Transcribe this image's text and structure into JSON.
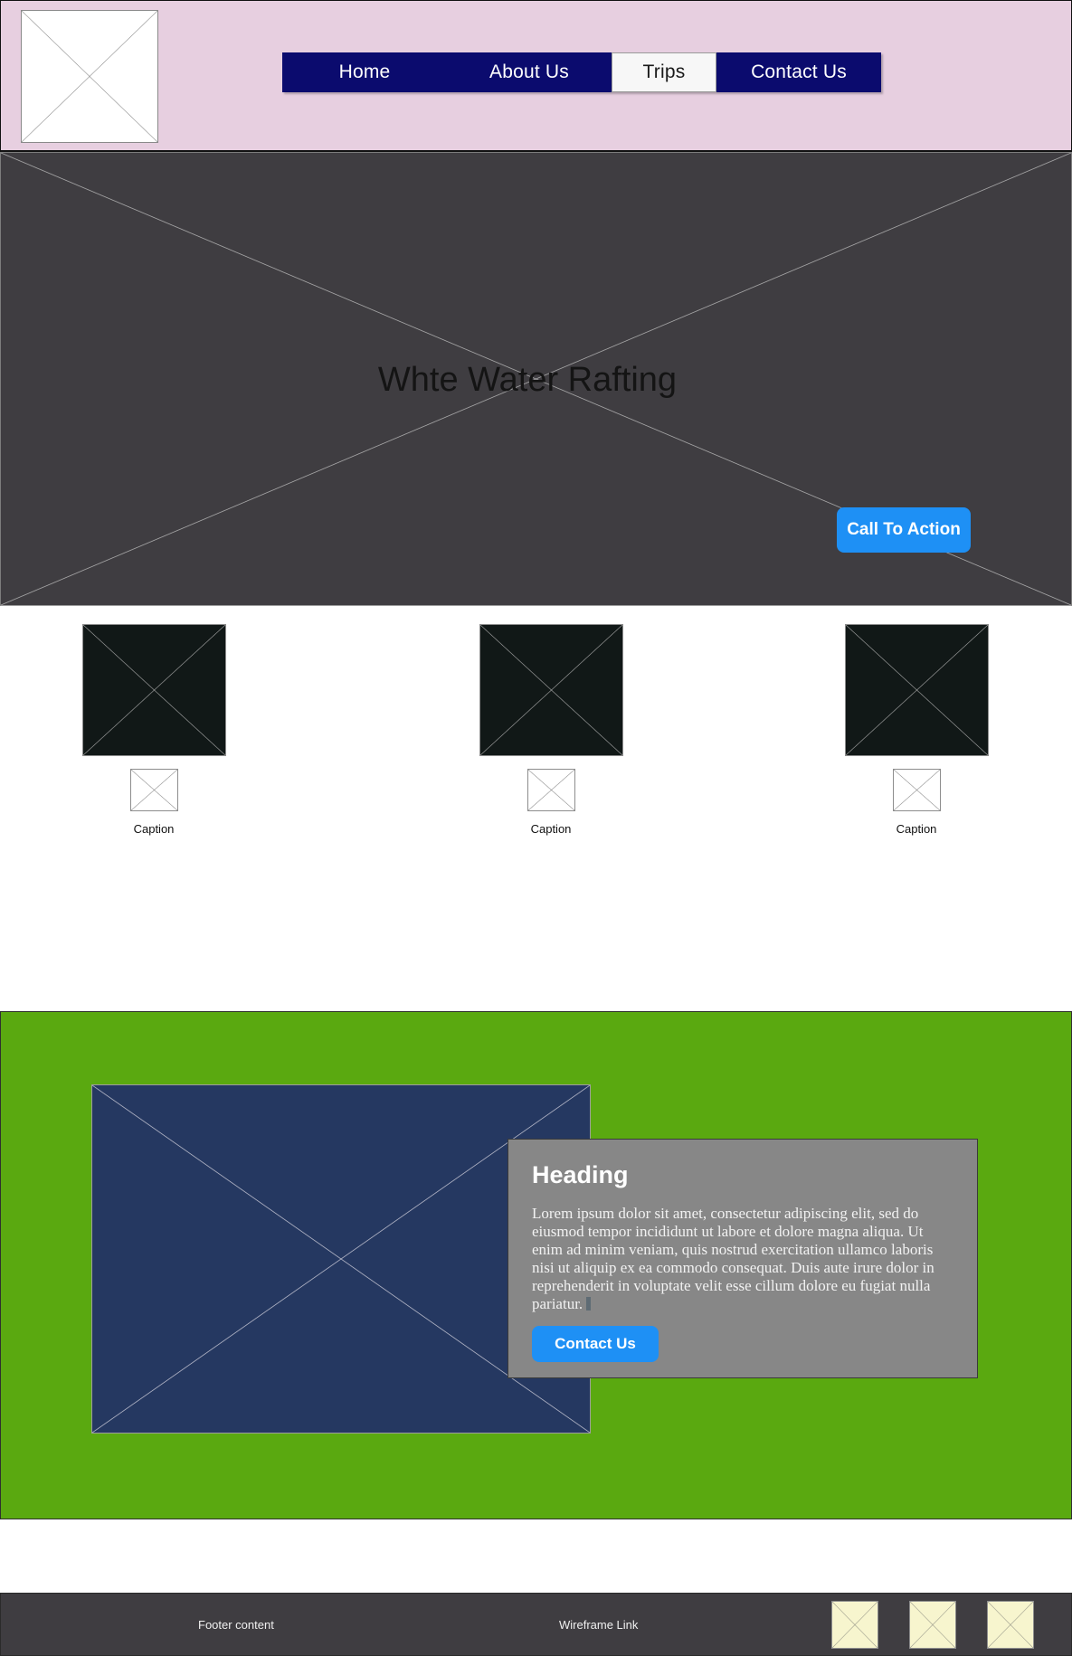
{
  "colors": {
    "header_bg": "#e7cfe0",
    "nav_bg": "#0b0b6e",
    "nav_active_bg": "#f7f7f7",
    "hero_bg": "#3f3d41",
    "accent_blue": "#1e90f5",
    "feature_green": "#5aa910",
    "feature_img": "#253861",
    "panel_gray": "#878787",
    "card_img": "#111817",
    "footer_bg": "#3f3d41",
    "footer_ph": "#f7f5ce"
  },
  "header": {
    "logo_alt": "image-placeholder",
    "nav": {
      "items": [
        {
          "label": "Home",
          "active": false
        },
        {
          "label": "About Us",
          "active": false
        },
        {
          "label": "Trips",
          "active": true
        },
        {
          "label": "Contact Us",
          "active": false
        }
      ]
    }
  },
  "hero": {
    "title": "Whte Water Rafting",
    "cta_label": "Call To Action",
    "image_alt": "hero-image-placeholder"
  },
  "cards": [
    {
      "caption": "Caption",
      "image_alt": "card-image-placeholder",
      "sub_alt": "card-sub-placeholder"
    },
    {
      "caption": "Caption",
      "image_alt": "card-image-placeholder",
      "sub_alt": "card-sub-placeholder"
    },
    {
      "caption": "Caption",
      "image_alt": "card-image-placeholder",
      "sub_alt": "card-sub-placeholder"
    }
  ],
  "feature": {
    "image_alt": "feature-image-placeholder",
    "heading": "Heading",
    "body": "Lorem ipsum dolor sit amet, consectetur adipiscing elit, sed do eiusmod tempor incididunt ut labore et dolore magna aliqua. Ut enim ad minim veniam, quis nostrud exercitation ullamco laboris nisi ut aliquip ex ea commodo consequat. Duis aute irure dolor in reprehenderit in voluptate velit esse cillum dolore eu fugiat nulla pariatur.",
    "button_label": "Contact Us"
  },
  "footer": {
    "content_label": "Footer content",
    "link_label": "Wireframe Link",
    "placeholders": [
      {
        "alt": "footer-placeholder-1"
      },
      {
        "alt": "footer-placeholder-2"
      },
      {
        "alt": "footer-placeholder-3"
      }
    ]
  }
}
